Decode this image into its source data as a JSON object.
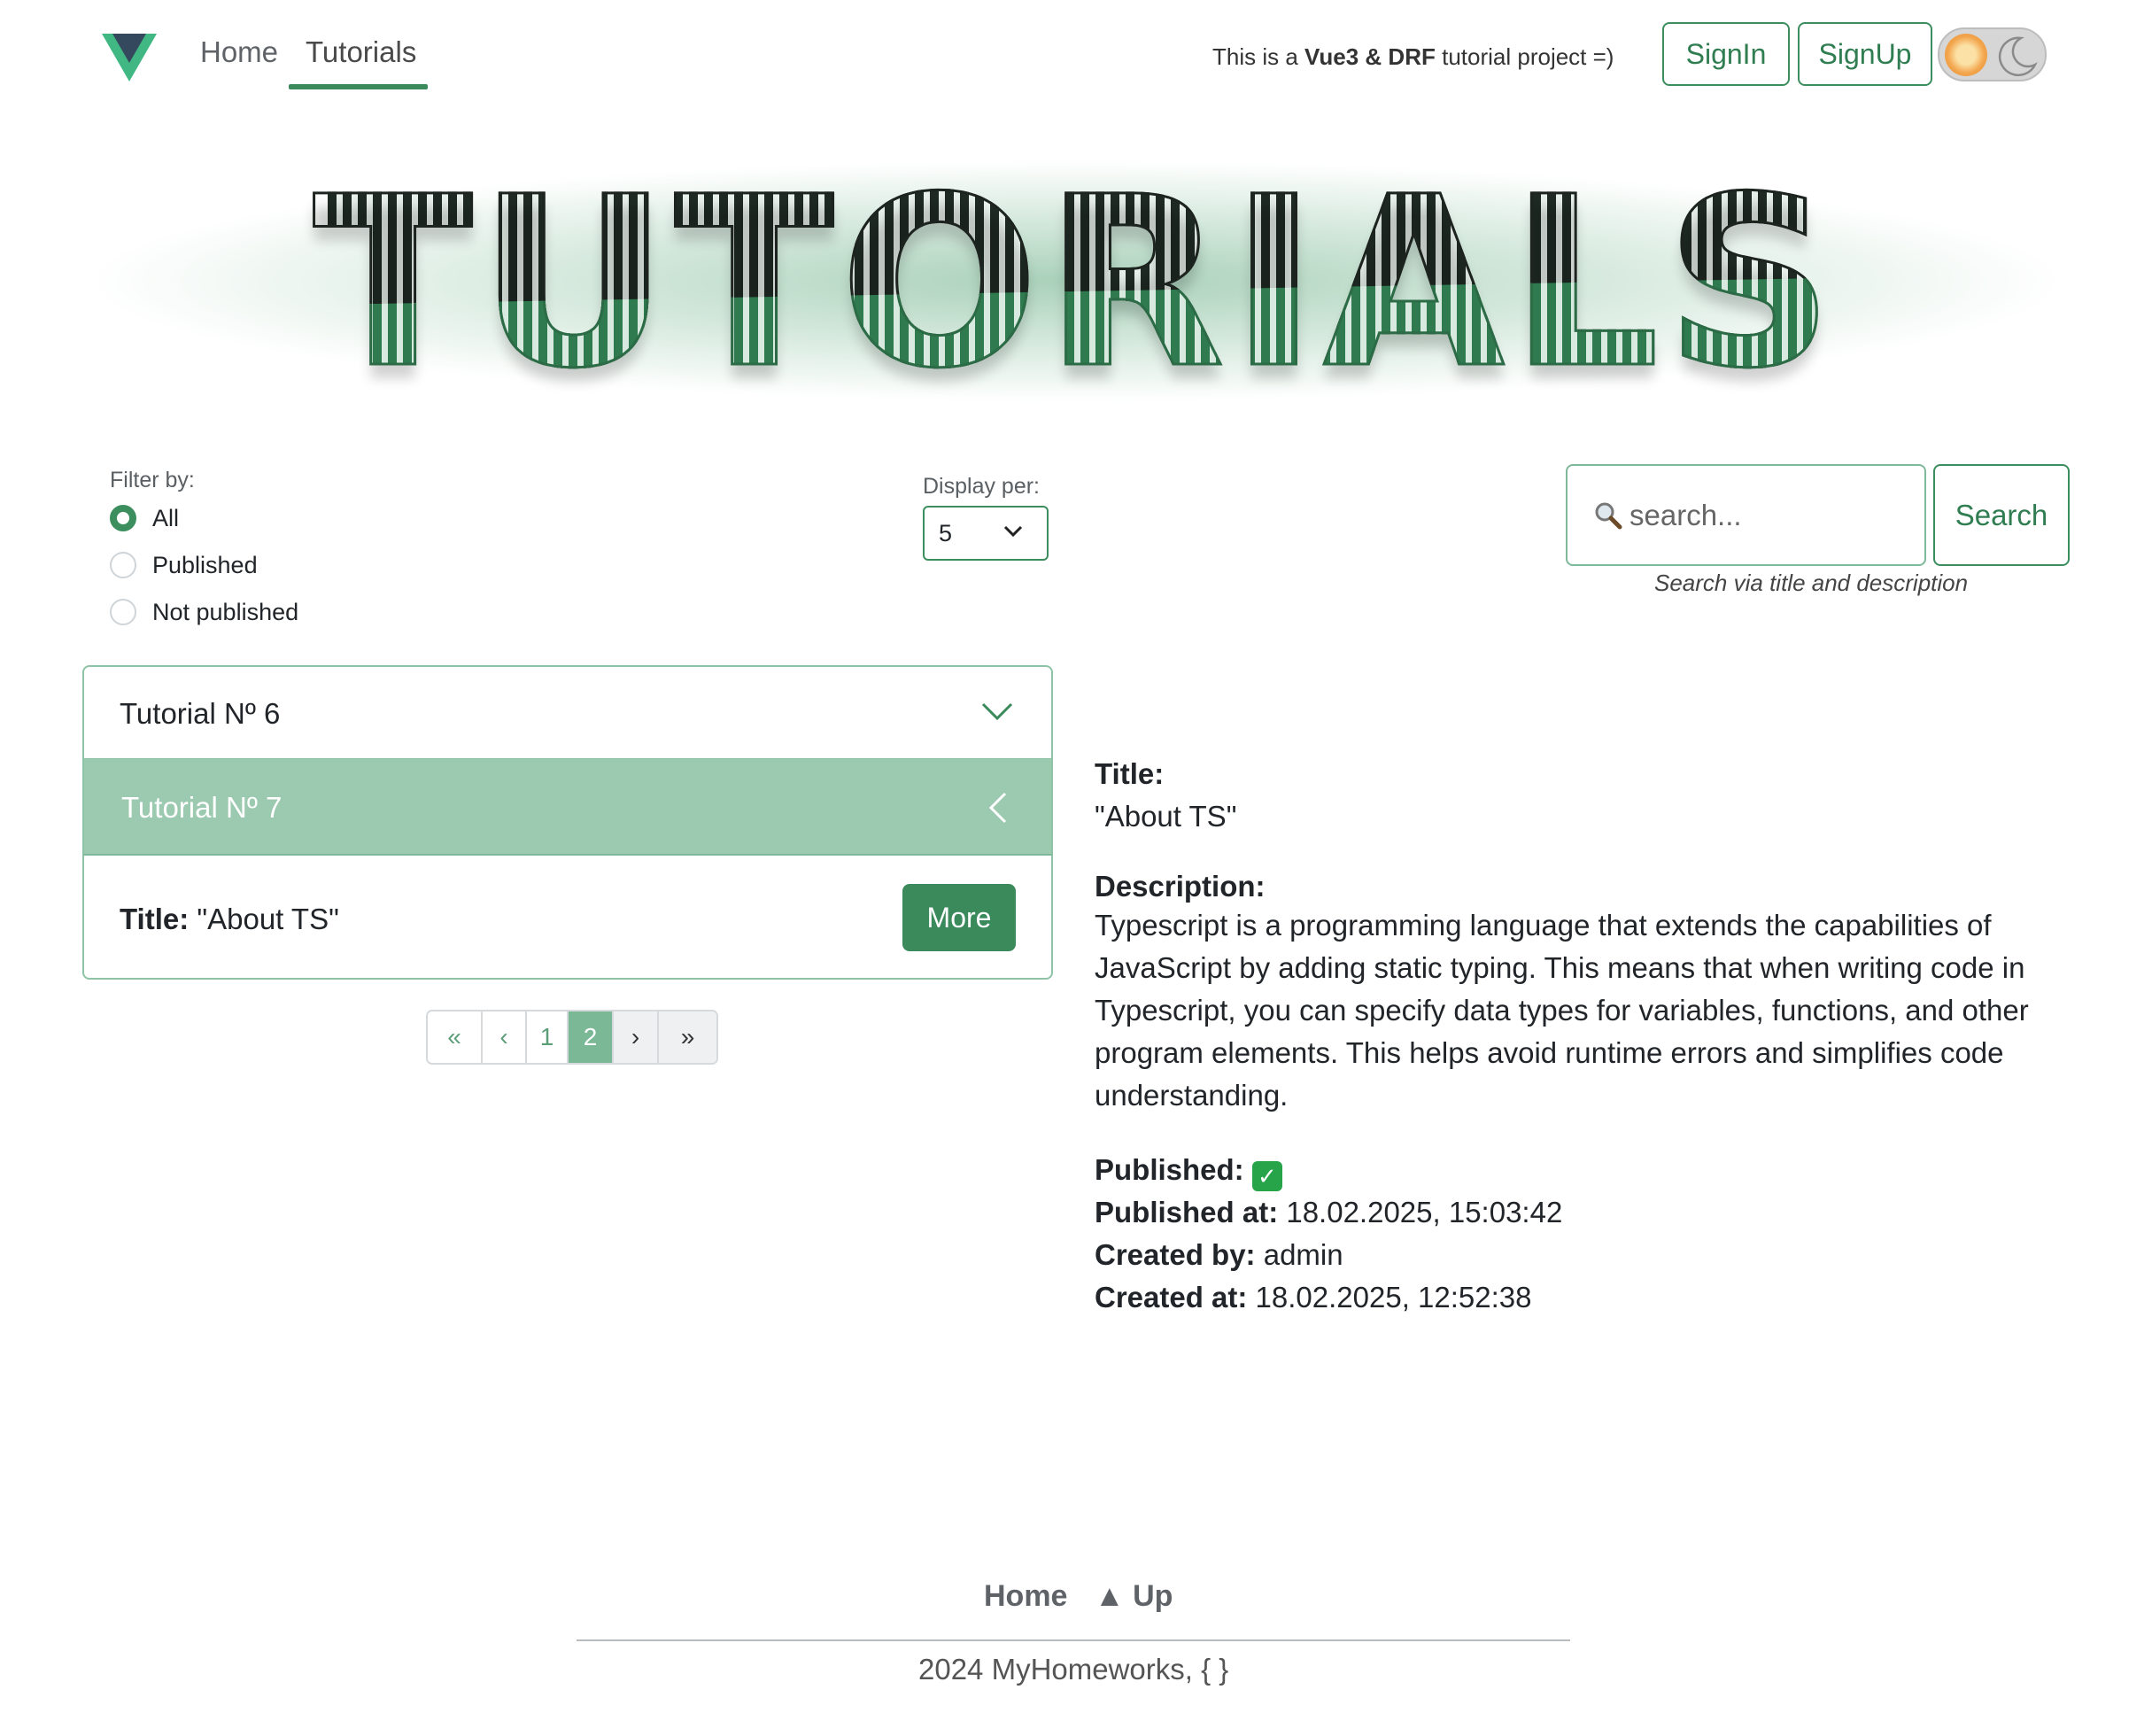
{
  "nav": {
    "links": [
      "Home",
      "Tutorials"
    ],
    "tagline_prefix": "This is a ",
    "tagline_bold": "Vue3 & DRF",
    "tagline_suffix": " tutorial project =)",
    "signin_label": "SignIn",
    "signup_label": "SignUp"
  },
  "hero": {
    "title": "TUTORIALS"
  },
  "filter": {
    "label": "Filter by:",
    "options": [
      "All",
      "Published",
      "Not published"
    ],
    "selected": "All"
  },
  "display": {
    "label": "Display per:",
    "value": "5"
  },
  "search": {
    "placeholder": "search...",
    "button_label": "Search",
    "help_text": "Search via title and description"
  },
  "accordion": {
    "items": [
      {
        "label": "Tutorial Nº 6",
        "expanded": false
      },
      {
        "label": "Tutorial Nº 7",
        "expanded": true,
        "body_label": "Title:",
        "body_value": " \"About TS\"",
        "more_label": "More"
      }
    ]
  },
  "pagination": {
    "first": "«",
    "prev": "‹",
    "pages": [
      "1",
      "2"
    ],
    "current": "2",
    "next": "›",
    "last": "»"
  },
  "details": {
    "title_label": "Title:",
    "title_value": "\"About TS\"",
    "description_label": "Description:",
    "description_value": "Typescript is a programming language that extends the capabilities of JavaScript by adding static typing. This means that when writing code in Typescript, you can specify data types for variables, functions, and other program elements. This helps avoid runtime errors and simplifies code understanding.",
    "published_label": "Published:",
    "published_icon": "check-mark-icon",
    "published_at_label": "Published at:",
    "published_at_value": " 18.02.2025, 15:03:42",
    "created_by_label": "Created by:",
    "created_by_value": " admin",
    "created_at_label": "Created at:",
    "created_at_value": " 18.02.2025, 12:52:38"
  },
  "footer": {
    "home_label": "Home",
    "up_label": "▲ Up",
    "copyright": "2024 MyHomeworks, { }"
  },
  "colors": {
    "accent": "#3a8a5c",
    "accent_light": "#9ccab0",
    "border_green": "#8fc3a6"
  }
}
